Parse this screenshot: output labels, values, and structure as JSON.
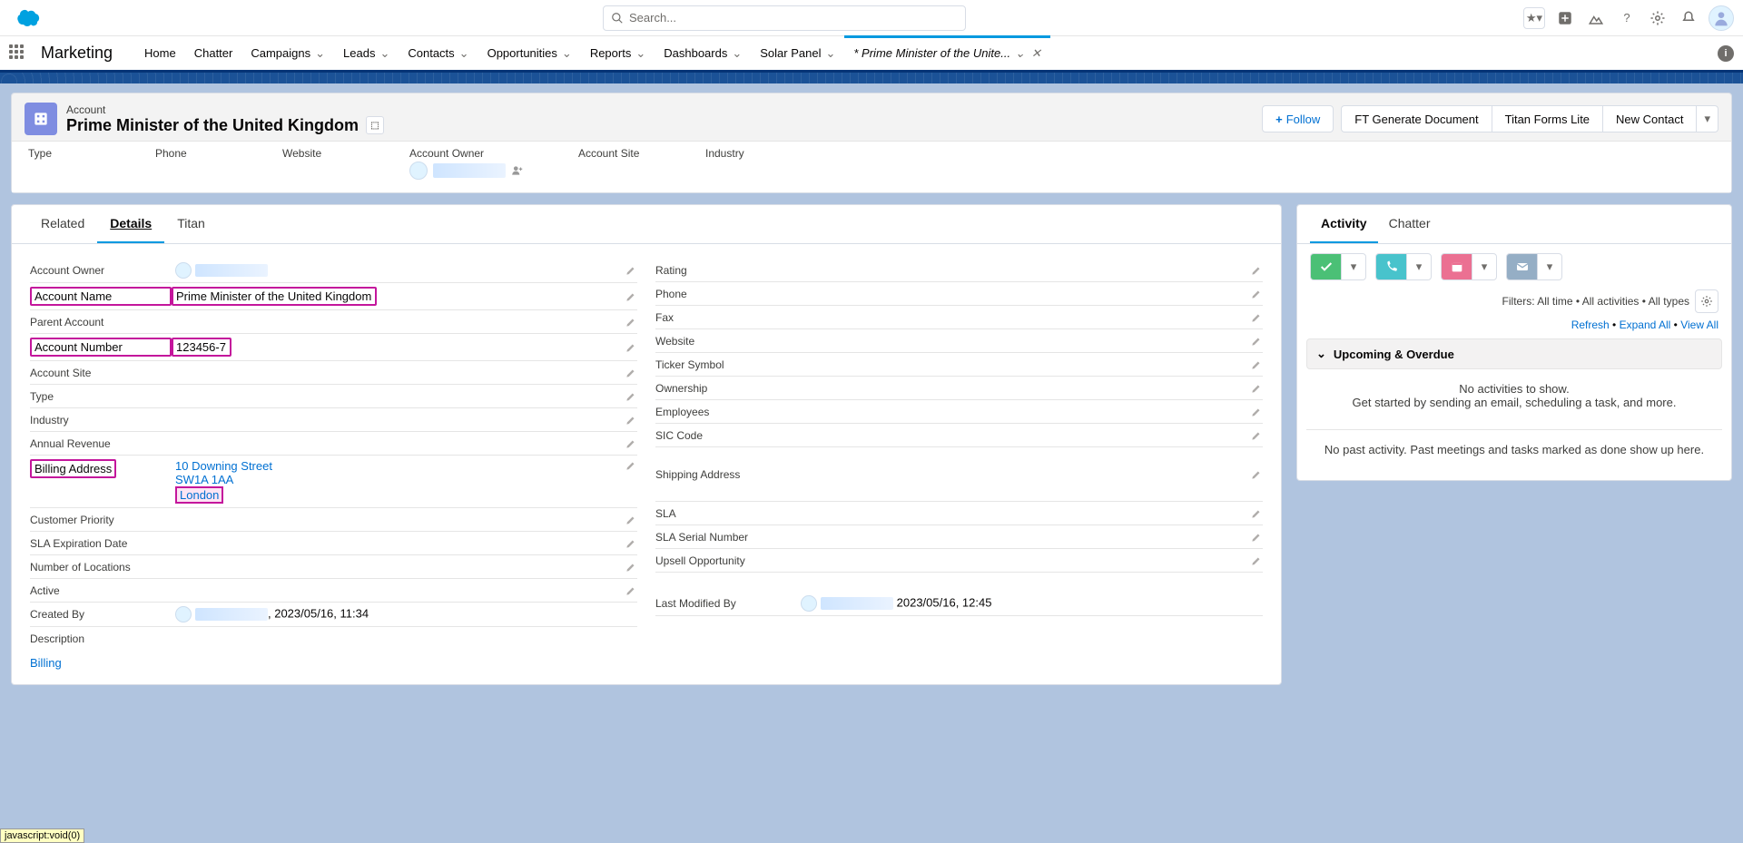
{
  "search": {
    "placeholder": "Search..."
  },
  "appName": "Marketing",
  "nav": {
    "items": [
      "Home",
      "Chatter",
      "Campaigns",
      "Leads",
      "Contacts",
      "Opportunities",
      "Reports",
      "Dashboards",
      "Solar Panel"
    ],
    "withDropdown": [
      false,
      false,
      true,
      true,
      true,
      true,
      true,
      true,
      true
    ],
    "activeTab": "* Prime Minister of the Unite..."
  },
  "record": {
    "objectLabel": "Account",
    "name": "Prime Minister of the United Kingdom",
    "actions": {
      "follow": "Follow",
      "gen": "FT Generate Document",
      "titan": "Titan Forms Lite",
      "new": "New Contact"
    },
    "compact": [
      "Type",
      "Phone",
      "Website",
      "Account Owner",
      "Account Site",
      "Industry"
    ]
  },
  "tabs": {
    "related": "Related",
    "details": "Details",
    "titan": "Titan"
  },
  "details": {
    "left": {
      "accountOwner": "Account Owner",
      "accountName": {
        "label": "Account Name",
        "value": "Prime Minister of the United Kingdom"
      },
      "parentAccount": "Parent Account",
      "accountNumber": {
        "label": "Account Number",
        "value": "123456-7"
      },
      "accountSite": "Account Site",
      "type": "Type",
      "industry": "Industry",
      "annualRevenue": "Annual Revenue",
      "billingAddress": {
        "label": "Billing Address",
        "line1": "10 Downing Street",
        "line2": "SW1A 1AA",
        "city": "London"
      },
      "custPriority": "Customer Priority",
      "slaExp": "SLA Expiration Date",
      "numLoc": "Number of Locations",
      "active": "Active",
      "createdBy": {
        "label": "Created By",
        "suffix": ", 2023/05/16, 11:34"
      },
      "description": "Description",
      "billingLink": "Billing"
    },
    "right": {
      "rating": "Rating",
      "phone": "Phone",
      "fax": "Fax",
      "website": "Website",
      "ticker": "Ticker Symbol",
      "ownership": "Ownership",
      "employees": "Employees",
      "sic": "SIC Code",
      "shipping": "Shipping Address",
      "sla": "SLA",
      "slaSerial": "SLA Serial Number",
      "upsell": "Upsell Opportunity",
      "lastMod": {
        "label": "Last Modified By",
        "suffix": "2023/05/16, 12:45"
      }
    }
  },
  "activity": {
    "tabs": {
      "activity": "Activity",
      "chatter": "Chatter"
    },
    "filters": "Filters: All time • All activities • All types",
    "links": {
      "refresh": "Refresh",
      "expand": "Expand All",
      "view": "View All"
    },
    "section": "Upcoming & Overdue",
    "empty1": "No activities to show.",
    "empty2": "Get started by sending an email, scheduling a task, and more.",
    "past": "No past activity. Past meetings and tasks marked as done show up here."
  },
  "statusBar": "javascript:void(0)"
}
